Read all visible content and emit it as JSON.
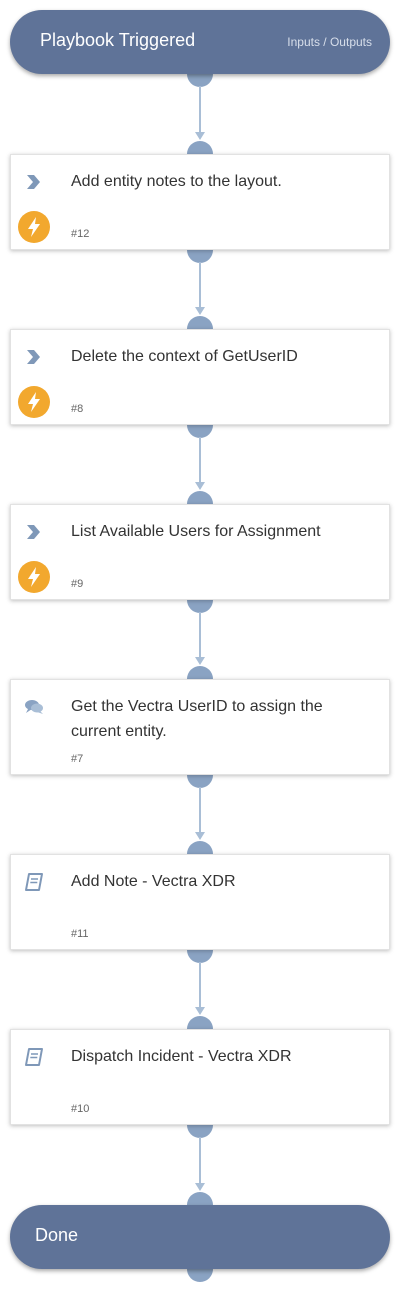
{
  "start": {
    "title": "Playbook Triggered",
    "io_label": "Inputs / Outputs"
  },
  "tasks": [
    {
      "label": "Add entity notes to the layout.",
      "number": "#12",
      "icon": "chevron-icon",
      "automated": true
    },
    {
      "label": "Delete the context of GetUserID",
      "number": "#8",
      "icon": "chevron-icon",
      "automated": true
    },
    {
      "label": "List Available Users for Assignment",
      "number": "#9",
      "icon": "chevron-icon",
      "automated": true
    },
    {
      "label": "Get the Vectra UserID to assign the current entity.",
      "number": "#7",
      "icon": "chat-icon",
      "automated": false
    },
    {
      "label": "Add Note - Vectra XDR",
      "number": "#11",
      "icon": "book-icon",
      "automated": false
    },
    {
      "label": "Dispatch Incident - Vectra XDR",
      "number": "#10",
      "icon": "book-icon",
      "automated": false
    }
  ],
  "end": {
    "title": "Done"
  },
  "colors": {
    "header_fill": "#5f7398",
    "connector": "#8aa3c3",
    "line": "#a9bed6",
    "bolt_badge": "#f2a82e"
  }
}
